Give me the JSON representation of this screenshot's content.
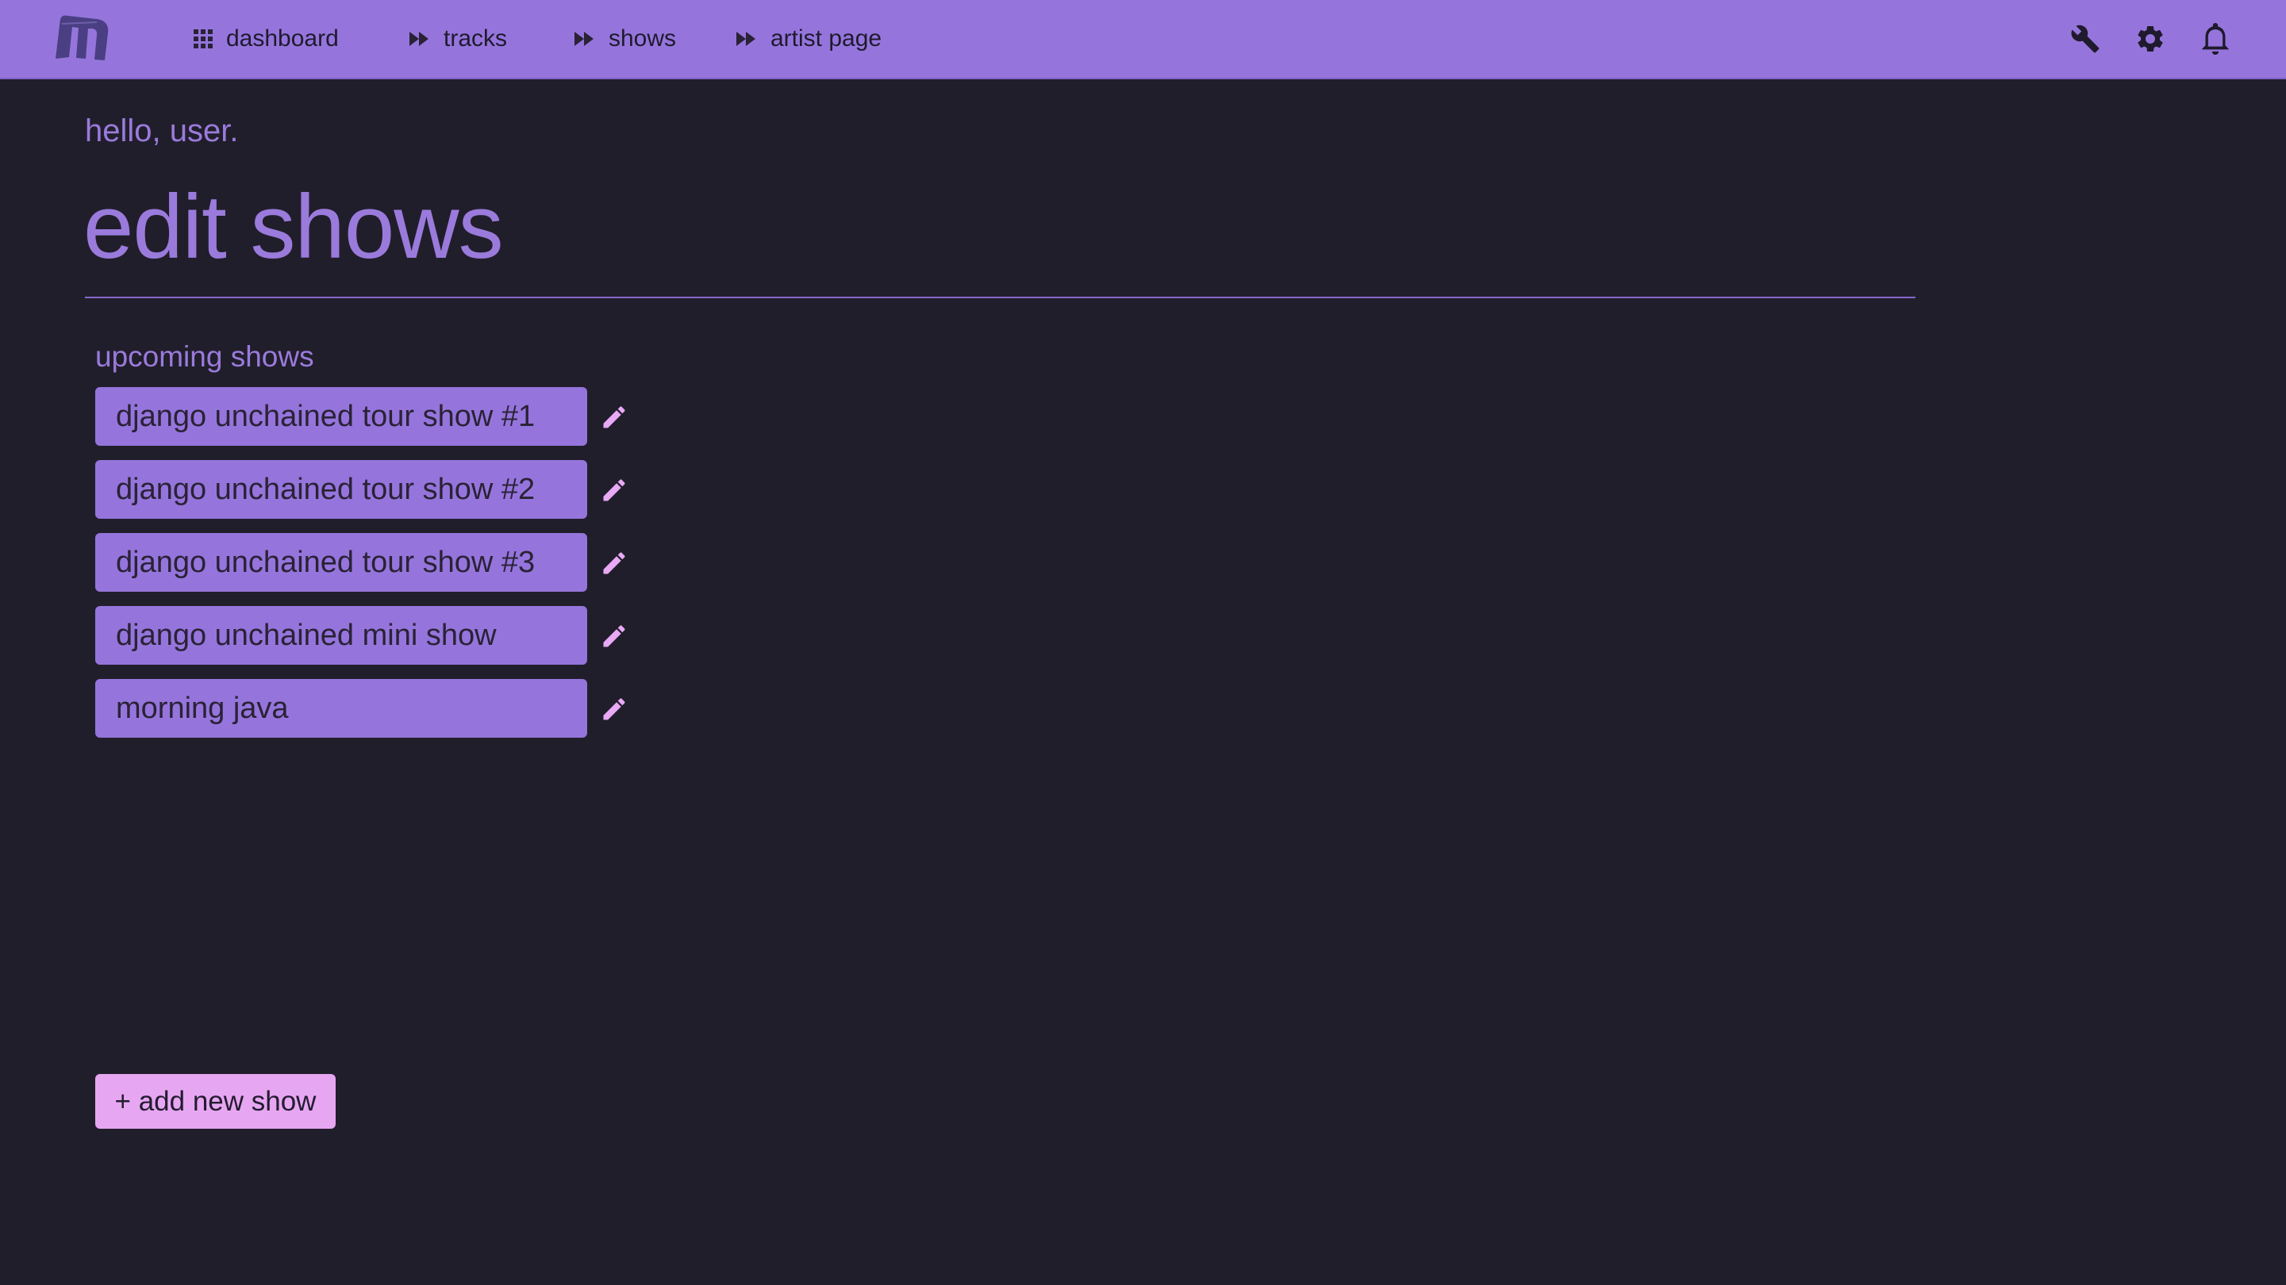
{
  "brand": {
    "logo_icon": "m-logo-icon"
  },
  "nav": {
    "items": [
      {
        "label": "dashboard",
        "icon": "grid-icon"
      },
      {
        "label": "tracks",
        "icon": "fast-forward-icon"
      },
      {
        "label": "shows",
        "icon": "fast-forward-icon"
      },
      {
        "label": "artist page",
        "icon": "fast-forward-icon"
      }
    ],
    "tools": [
      "wrench-icon",
      "gear-icon",
      "bell-icon"
    ]
  },
  "greeting": "hello, user.",
  "page_title": "edit shows",
  "section": {
    "label": "upcoming shows",
    "shows": [
      "django unchained tour show #1",
      "django unchained tour show #2",
      "django unchained tour show #3",
      "django unchained mini show",
      "morning java"
    ]
  },
  "add_button": "+ add new show",
  "colors": {
    "background": "#211e2b",
    "accent": "#9575dc",
    "accent_text": "#9a7bdc",
    "button_pink": "#e7a6f2",
    "edit_icon": "#e8a9f5"
  }
}
